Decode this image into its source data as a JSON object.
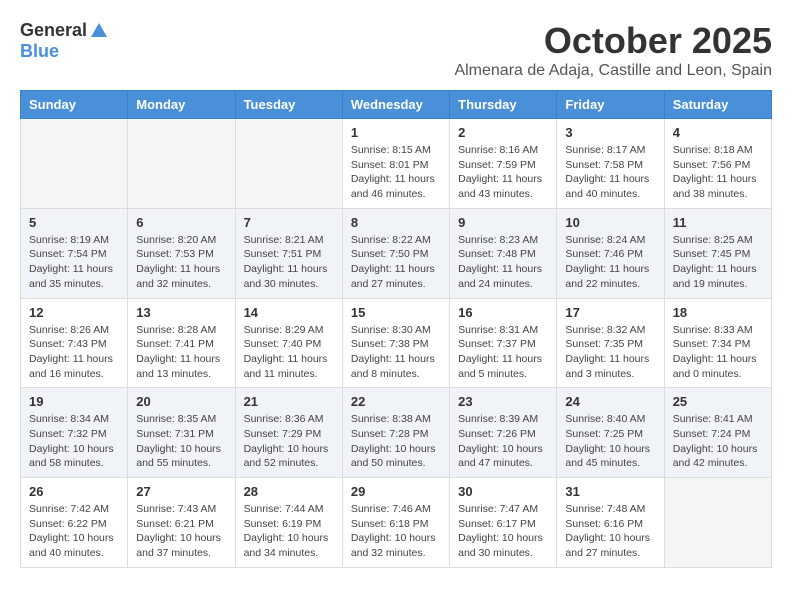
{
  "header": {
    "logo_general": "General",
    "logo_blue": "Blue",
    "month_title": "October 2025",
    "subtitle": "Almenara de Adaja, Castille and Leon, Spain"
  },
  "weekdays": [
    "Sunday",
    "Monday",
    "Tuesday",
    "Wednesday",
    "Thursday",
    "Friday",
    "Saturday"
  ],
  "weeks": [
    [
      {
        "day": "",
        "info": ""
      },
      {
        "day": "",
        "info": ""
      },
      {
        "day": "",
        "info": ""
      },
      {
        "day": "1",
        "info": "Sunrise: 8:15 AM\nSunset: 8:01 PM\nDaylight: 11 hours and 46 minutes."
      },
      {
        "day": "2",
        "info": "Sunrise: 8:16 AM\nSunset: 7:59 PM\nDaylight: 11 hours and 43 minutes."
      },
      {
        "day": "3",
        "info": "Sunrise: 8:17 AM\nSunset: 7:58 PM\nDaylight: 11 hours and 40 minutes."
      },
      {
        "day": "4",
        "info": "Sunrise: 8:18 AM\nSunset: 7:56 PM\nDaylight: 11 hours and 38 minutes."
      }
    ],
    [
      {
        "day": "5",
        "info": "Sunrise: 8:19 AM\nSunset: 7:54 PM\nDaylight: 11 hours and 35 minutes."
      },
      {
        "day": "6",
        "info": "Sunrise: 8:20 AM\nSunset: 7:53 PM\nDaylight: 11 hours and 32 minutes."
      },
      {
        "day": "7",
        "info": "Sunrise: 8:21 AM\nSunset: 7:51 PM\nDaylight: 11 hours and 30 minutes."
      },
      {
        "day": "8",
        "info": "Sunrise: 8:22 AM\nSunset: 7:50 PM\nDaylight: 11 hours and 27 minutes."
      },
      {
        "day": "9",
        "info": "Sunrise: 8:23 AM\nSunset: 7:48 PM\nDaylight: 11 hours and 24 minutes."
      },
      {
        "day": "10",
        "info": "Sunrise: 8:24 AM\nSunset: 7:46 PM\nDaylight: 11 hours and 22 minutes."
      },
      {
        "day": "11",
        "info": "Sunrise: 8:25 AM\nSunset: 7:45 PM\nDaylight: 11 hours and 19 minutes."
      }
    ],
    [
      {
        "day": "12",
        "info": "Sunrise: 8:26 AM\nSunset: 7:43 PM\nDaylight: 11 hours and 16 minutes."
      },
      {
        "day": "13",
        "info": "Sunrise: 8:28 AM\nSunset: 7:41 PM\nDaylight: 11 hours and 13 minutes."
      },
      {
        "day": "14",
        "info": "Sunrise: 8:29 AM\nSunset: 7:40 PM\nDaylight: 11 hours and 11 minutes."
      },
      {
        "day": "15",
        "info": "Sunrise: 8:30 AM\nSunset: 7:38 PM\nDaylight: 11 hours and 8 minutes."
      },
      {
        "day": "16",
        "info": "Sunrise: 8:31 AM\nSunset: 7:37 PM\nDaylight: 11 hours and 5 minutes."
      },
      {
        "day": "17",
        "info": "Sunrise: 8:32 AM\nSunset: 7:35 PM\nDaylight: 11 hours and 3 minutes."
      },
      {
        "day": "18",
        "info": "Sunrise: 8:33 AM\nSunset: 7:34 PM\nDaylight: 11 hours and 0 minutes."
      }
    ],
    [
      {
        "day": "19",
        "info": "Sunrise: 8:34 AM\nSunset: 7:32 PM\nDaylight: 10 hours and 58 minutes."
      },
      {
        "day": "20",
        "info": "Sunrise: 8:35 AM\nSunset: 7:31 PM\nDaylight: 10 hours and 55 minutes."
      },
      {
        "day": "21",
        "info": "Sunrise: 8:36 AM\nSunset: 7:29 PM\nDaylight: 10 hours and 52 minutes."
      },
      {
        "day": "22",
        "info": "Sunrise: 8:38 AM\nSunset: 7:28 PM\nDaylight: 10 hours and 50 minutes."
      },
      {
        "day": "23",
        "info": "Sunrise: 8:39 AM\nSunset: 7:26 PM\nDaylight: 10 hours and 47 minutes."
      },
      {
        "day": "24",
        "info": "Sunrise: 8:40 AM\nSunset: 7:25 PM\nDaylight: 10 hours and 45 minutes."
      },
      {
        "day": "25",
        "info": "Sunrise: 8:41 AM\nSunset: 7:24 PM\nDaylight: 10 hours and 42 minutes."
      }
    ],
    [
      {
        "day": "26",
        "info": "Sunrise: 7:42 AM\nSunset: 6:22 PM\nDaylight: 10 hours and 40 minutes."
      },
      {
        "day": "27",
        "info": "Sunrise: 7:43 AM\nSunset: 6:21 PM\nDaylight: 10 hours and 37 minutes."
      },
      {
        "day": "28",
        "info": "Sunrise: 7:44 AM\nSunset: 6:19 PM\nDaylight: 10 hours and 34 minutes."
      },
      {
        "day": "29",
        "info": "Sunrise: 7:46 AM\nSunset: 6:18 PM\nDaylight: 10 hours and 32 minutes."
      },
      {
        "day": "30",
        "info": "Sunrise: 7:47 AM\nSunset: 6:17 PM\nDaylight: 10 hours and 30 minutes."
      },
      {
        "day": "31",
        "info": "Sunrise: 7:48 AM\nSunset: 6:16 PM\nDaylight: 10 hours and 27 minutes."
      },
      {
        "day": "",
        "info": ""
      }
    ]
  ]
}
